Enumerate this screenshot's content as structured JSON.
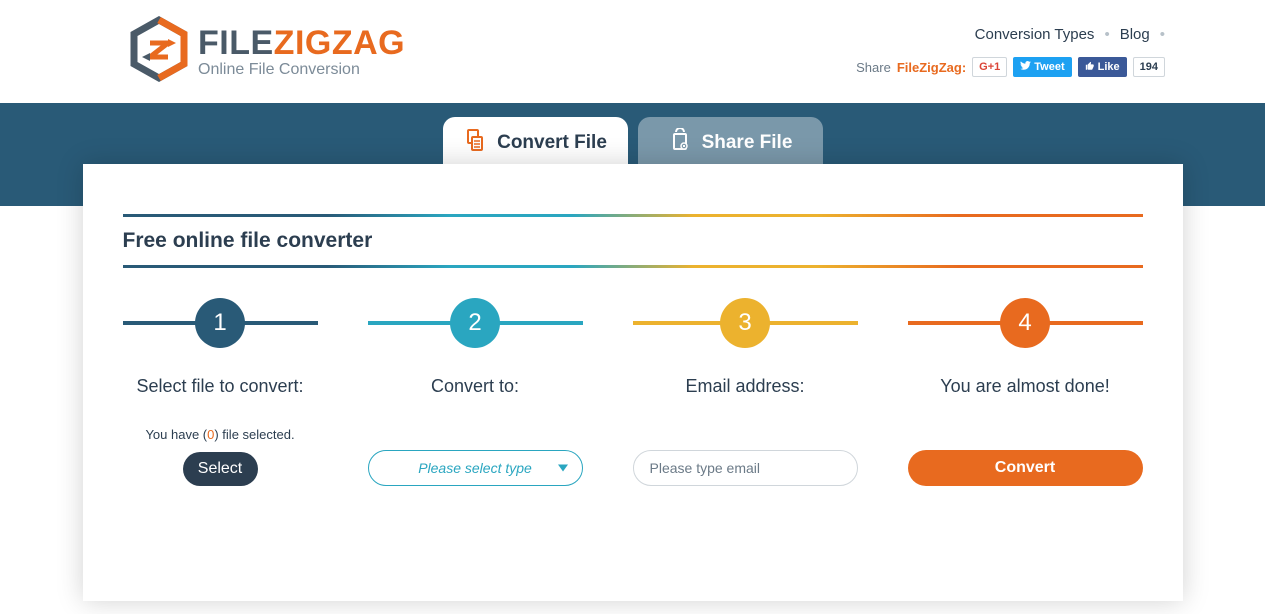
{
  "logo": {
    "part1": "FILE",
    "part2": "ZIGZAG",
    "subtitle": "Online File Conversion"
  },
  "nav": {
    "conversion_types": "Conversion Types",
    "blog": "Blog"
  },
  "share": {
    "prefix": "Share",
    "brand": "FileZigZag:",
    "gplus": "G+1",
    "tweet": "Tweet",
    "fblike": "Like",
    "fbcount": "194"
  },
  "tabs": {
    "convert": "Convert File",
    "share": "Share File"
  },
  "panel": {
    "title": "Free online file converter"
  },
  "steps": [
    {
      "num": "1",
      "title": "Select file to convert:",
      "sub_before": "You have (",
      "sub_count": "0",
      "sub_after": ") file selected.",
      "button": "Select"
    },
    {
      "num": "2",
      "title": "Convert to:",
      "placeholder": "Please select type"
    },
    {
      "num": "3",
      "title": "Email address:",
      "placeholder": "Please type email"
    },
    {
      "num": "4",
      "title": "You are almost done!",
      "button": "Convert"
    }
  ]
}
